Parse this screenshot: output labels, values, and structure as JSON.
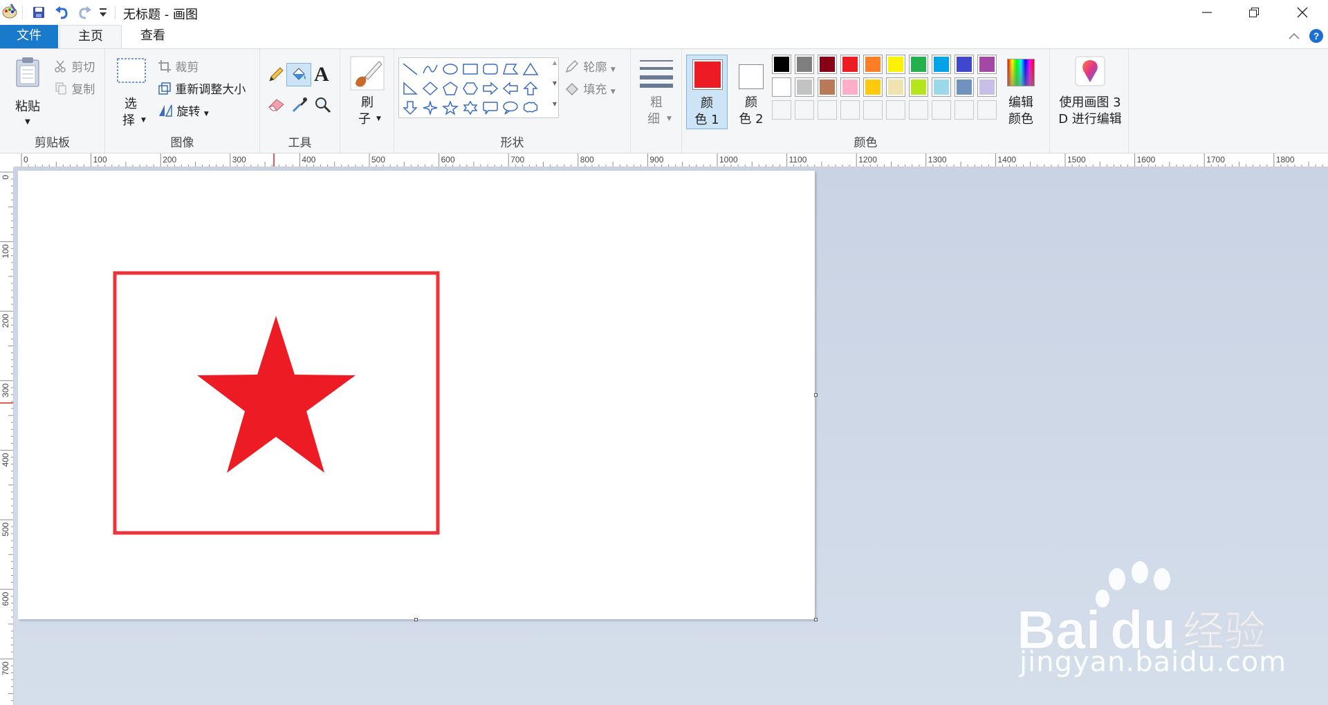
{
  "window": {
    "title": "无标题 - 画图"
  },
  "tabs": {
    "file": "文件",
    "home": "主页",
    "view": "查看"
  },
  "ribbon": {
    "clipboard": {
      "label": "剪贴板",
      "paste": "粘贴",
      "cut": "剪切",
      "copy": "复制"
    },
    "image": {
      "label": "图像",
      "select_line1": "选",
      "select_line2": "择",
      "crop": "裁剪",
      "resize": "重新调整大小",
      "rotate": "旋转"
    },
    "tools": {
      "label": "工具"
    },
    "brushes": {
      "line1": "刷",
      "line2": "子"
    },
    "shapes": {
      "label": "形状",
      "outline": "轮廓",
      "fill": "填充"
    },
    "size": {
      "line1": "粗",
      "line2": "细"
    },
    "colors": {
      "label": "颜色",
      "color1_line1": "颜",
      "color1_line2": "色 1",
      "color2_line1": "颜",
      "color2_line2": "色 2",
      "edit_line1": "编辑",
      "edit_line2": "颜色",
      "color1_value": "#ed1c24",
      "color2_value": "#ffffff",
      "palette_row1": [
        "#000000",
        "#7f7f7f",
        "#880015",
        "#ed1c24",
        "#ff7f27",
        "#fff200",
        "#22b14c",
        "#00a2e8",
        "#3f48cc",
        "#a349a4"
      ],
      "palette_row2": [
        "#ffffff",
        "#c3c3c3",
        "#b97a57",
        "#ffaec9",
        "#ffc90e",
        "#efe4b0",
        "#b5e61d",
        "#99d9ea",
        "#7092be",
        "#c8bfe7"
      ]
    },
    "paint3d": {
      "line1": "使用画图 3",
      "line2": "D 进行编辑"
    }
  },
  "ruler": {
    "h_labels": [
      "0",
      "100",
      "200",
      "300",
      "400",
      "500",
      "600",
      "700",
      "800",
      "900",
      "1000",
      "1100",
      "1200",
      "1300",
      "1400",
      "1500",
      "1600",
      "1700",
      "1800"
    ],
    "v_labels": [
      "0",
      "100",
      "200",
      "300",
      "400",
      "500",
      "600",
      "700"
    ]
  },
  "canvas": {
    "rect_color": "#ed3338",
    "star_color": "#ed1c24"
  },
  "watermark": {
    "brand": "Bai",
    "brand_tail": "du",
    "brand_cn": "经验",
    "url": "jingyan.baidu.com"
  }
}
